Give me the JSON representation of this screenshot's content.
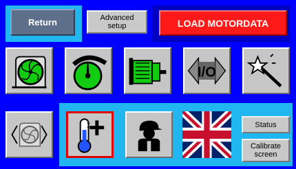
{
  "buttons": {
    "return_label": "Return",
    "advanced_setup_label": "Advanced setup",
    "load_motordata_label": "LOAD MOTORDATA",
    "status_label": "Status",
    "calibrate_label": "Calibrate screen"
  },
  "icons": {
    "row1": [
      "fan-icon",
      "speedometer-icon",
      "motor-icon",
      "io-icon",
      "magic-wand-icon"
    ],
    "row2": [
      "fan-outline-icon",
      "thermometer-plus-icon",
      "user-settings-icon",
      "uk-flag-icon"
    ]
  },
  "colors": {
    "background": "#0000ff",
    "highlight": "#21b6f0",
    "load_button": "#ff1a1a",
    "icon_green": "#11cc11",
    "active_border": "#e00000"
  }
}
